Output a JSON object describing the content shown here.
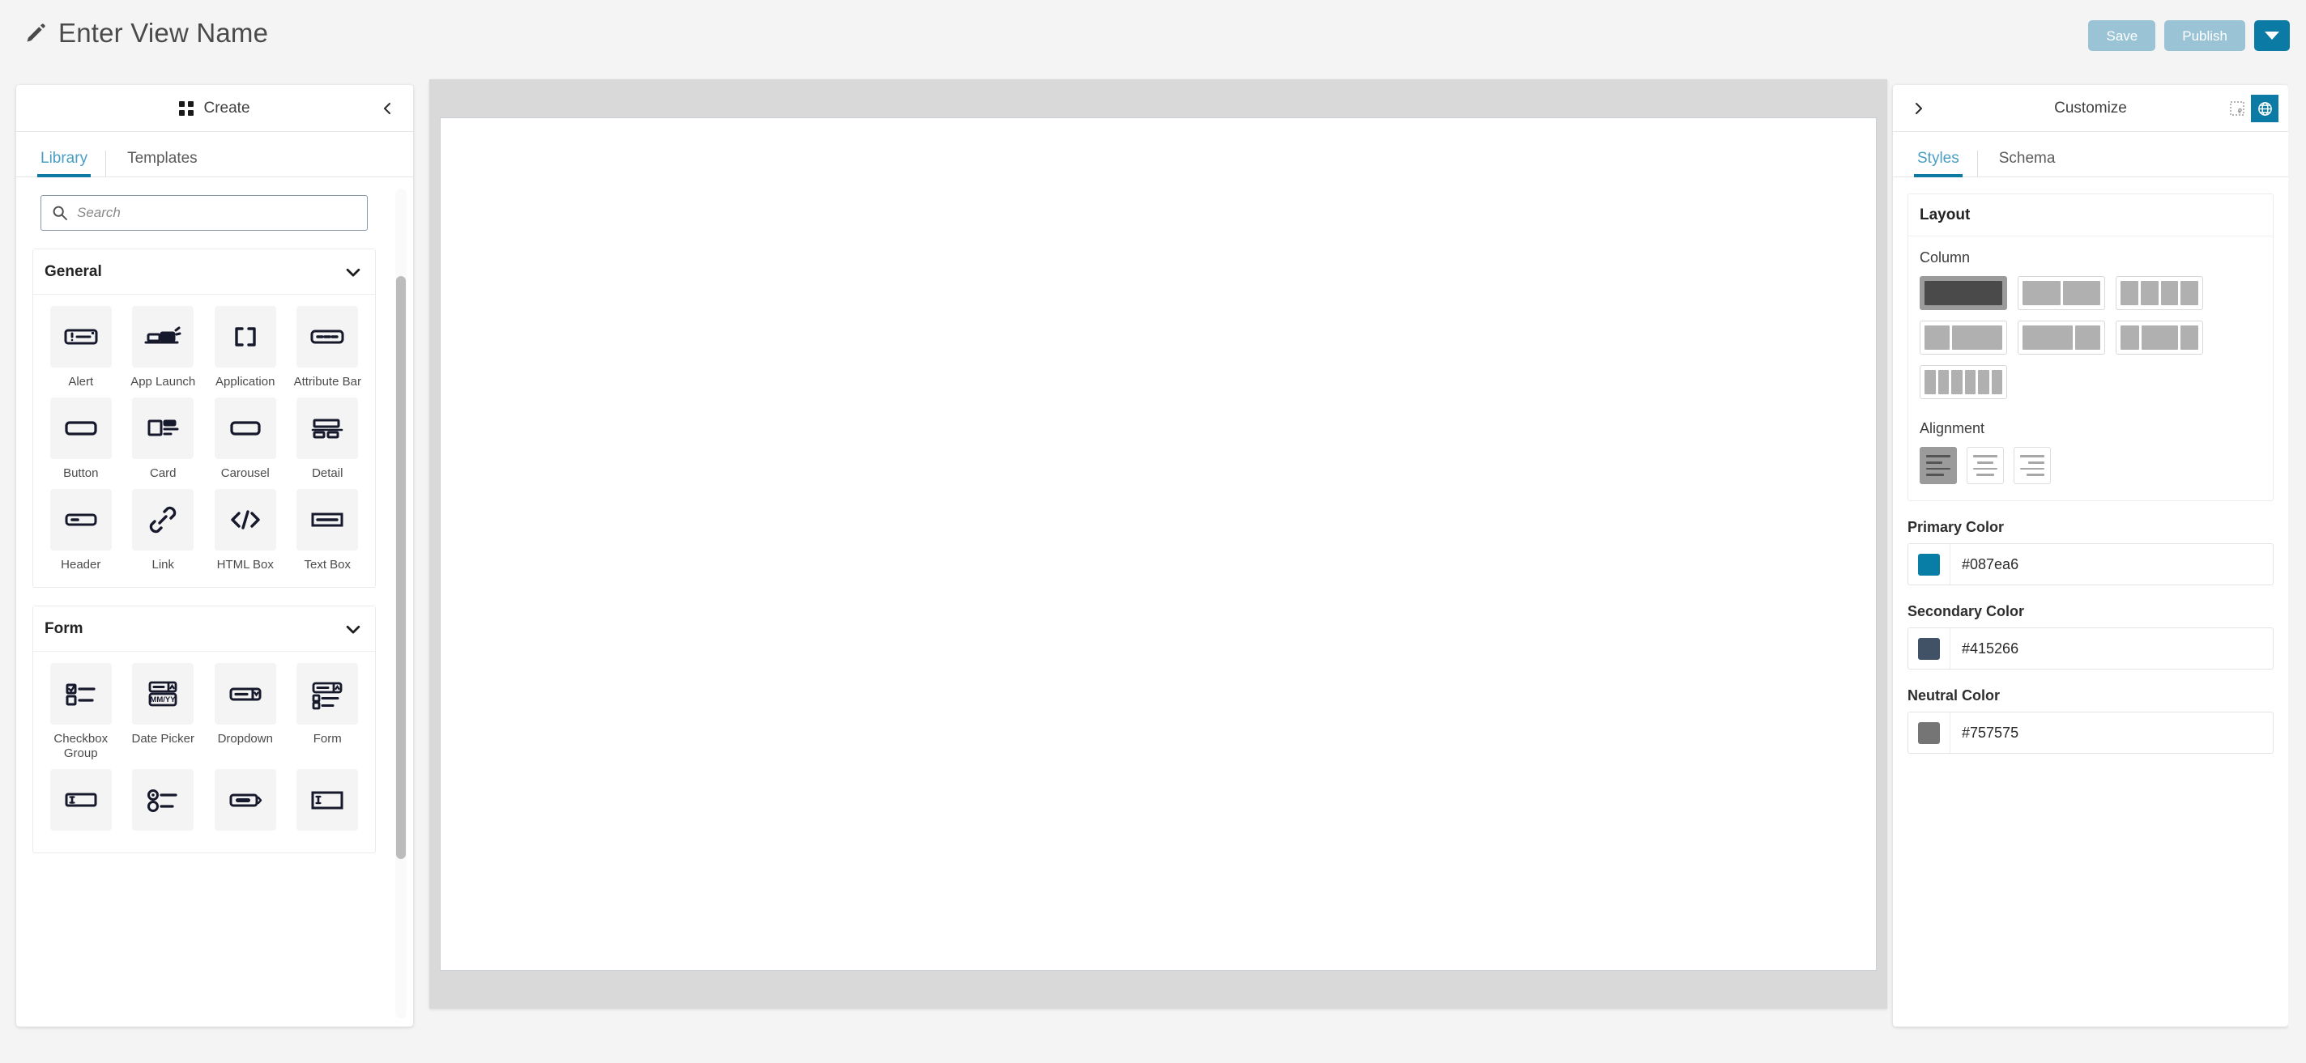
{
  "topbar": {
    "pencil_icon": "pencil-icon",
    "title": "Enter View Name",
    "save_label": "Save",
    "publish_label": "Publish",
    "dropdown_icon": "caret-down-icon"
  },
  "left_panel": {
    "header_title": "Create",
    "header_icon": "grid-icon",
    "collapse_icon": "chevron-left-icon",
    "tabs": [
      {
        "label": "Library",
        "active": true
      },
      {
        "label": "Templates",
        "active": false
      }
    ],
    "search": {
      "placeholder": "Search",
      "value": "",
      "icon": "search-icon"
    },
    "sections": [
      {
        "title": "General",
        "toggle_icon": "chevron-down-icon",
        "expanded": true,
        "components": [
          {
            "label": "Alert",
            "icon": "alert-box-icon"
          },
          {
            "label": "App Launch",
            "icon": "app-launch-icon"
          },
          {
            "label": "Application",
            "icon": "brackets-icon"
          },
          {
            "label": "Attribute Bar",
            "icon": "attribute-bar-icon"
          },
          {
            "label": "Button",
            "icon": "button-icon"
          },
          {
            "label": "Card",
            "icon": "card-icon"
          },
          {
            "label": "Carousel",
            "icon": "carousel-icon"
          },
          {
            "label": "Detail",
            "icon": "detail-icon"
          },
          {
            "label": "Header",
            "icon": "header-icon"
          },
          {
            "label": "Link",
            "icon": "link-icon"
          },
          {
            "label": "HTML Box",
            "icon": "code-icon"
          },
          {
            "label": "Text Box",
            "icon": "text-box-icon"
          }
        ]
      },
      {
        "title": "Form",
        "toggle_icon": "chevron-down-icon",
        "expanded": true,
        "components": [
          {
            "label": "Checkbox Group",
            "icon": "checkbox-group-icon"
          },
          {
            "label": "Date Picker",
            "icon": "date-picker-icon"
          },
          {
            "label": "Dropdown",
            "icon": "dropdown-icon"
          },
          {
            "label": "Form",
            "icon": "form-icon"
          },
          {
            "label": "",
            "icon": "input-field-icon"
          },
          {
            "label": "",
            "icon": "radio-group-icon"
          },
          {
            "label": "",
            "icon": "slider-icon"
          },
          {
            "label": "",
            "icon": "text-area-icon"
          }
        ]
      }
    ]
  },
  "right_panel": {
    "header_title": "Customize",
    "expand_icon": "chevron-right-icon",
    "toggles": [
      {
        "name": "artboard-icon",
        "active": false
      },
      {
        "name": "globe-icon",
        "active": true
      }
    ],
    "tabs": [
      {
        "label": "Styles",
        "active": true
      },
      {
        "label": "Schema",
        "active": false
      }
    ],
    "layout": {
      "section_title": "Layout",
      "column_label": "Column",
      "column_options": [
        {
          "name": "1-column",
          "segments": [
            1
          ],
          "selected": true
        },
        {
          "name": "2-column",
          "segments": [
            1,
            1
          ],
          "selected": false
        },
        {
          "name": "4-column",
          "segments": [
            1,
            1,
            1,
            1
          ],
          "selected": false
        },
        {
          "name": "one-third-two-thirds",
          "segments": [
            1,
            2
          ],
          "selected": false
        },
        {
          "name": "two-thirds-one-third",
          "segments": [
            2,
            1
          ],
          "selected": false
        },
        {
          "name": "three-column-wide-center",
          "segments": [
            1,
            2,
            1
          ],
          "selected": false
        },
        {
          "name": "6-column",
          "segments": [
            1,
            1,
            1,
            1,
            1,
            1
          ],
          "selected": false
        }
      ],
      "alignment_label": "Alignment",
      "alignment_options": [
        {
          "name": "align-left",
          "selected": true
        },
        {
          "name": "align-center",
          "selected": false
        },
        {
          "name": "align-right",
          "selected": false
        }
      ]
    },
    "colors": [
      {
        "label": "Primary Color",
        "value": "#087ea6",
        "swatch": "#087ea6"
      },
      {
        "label": "Secondary Color",
        "value": "#415266",
        "swatch": "#415266"
      },
      {
        "label": "Neutral Color",
        "value": "#757575",
        "swatch": "#757575"
      }
    ]
  },
  "theme": {
    "accent": "#0b7ba5",
    "accent_muted": "#9ac4d6",
    "tab_active_text": "#4a9ec4",
    "page_bg": "#f4f4f4",
    "canvas_frame": "#d9d9d9"
  }
}
